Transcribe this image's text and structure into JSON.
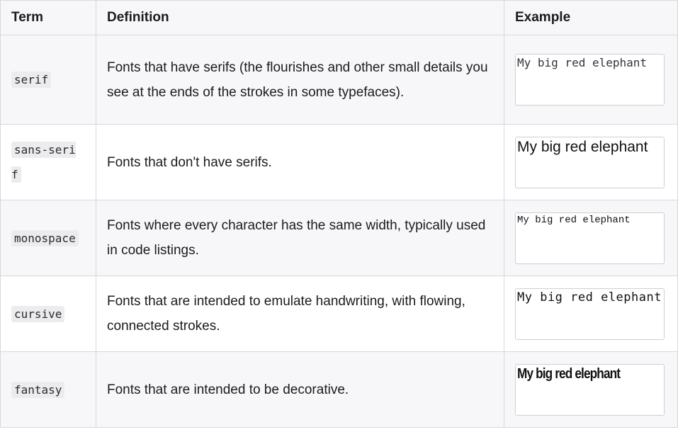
{
  "table": {
    "headers": {
      "term": "Term",
      "definition": "Definition",
      "example": "Example"
    },
    "rows": [
      {
        "term": "serif",
        "definition": "Fonts that have serifs (the flourishes and other small details you see at the ends of the strokes in some typefaces).",
        "example": "My big red elephant"
      },
      {
        "term": "sans-serif",
        "definition": "Fonts that don't have serifs.",
        "example": "My big red elephant"
      },
      {
        "term": "monospace",
        "definition": "Fonts where every character has the same width, typically used in code listings.",
        "example": "My big red elephant"
      },
      {
        "term": "cursive",
        "definition": "Fonts that are intended to emulate handwriting, with flowing, connected strokes.",
        "example": "My big red elephant"
      },
      {
        "term": "fantasy",
        "definition": "Fonts that are intended to be decorative.",
        "example": "My big red elephant"
      }
    ]
  }
}
